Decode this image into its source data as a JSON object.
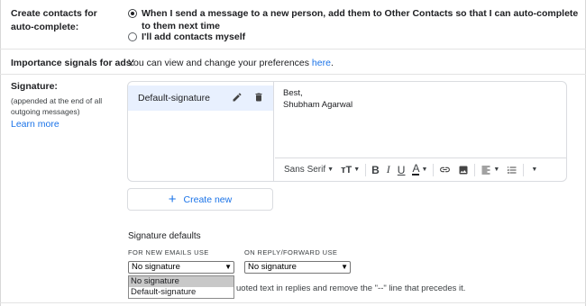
{
  "contacts": {
    "label": "Create contacts for auto-complete:",
    "options": [
      {
        "label": "When I send a message to a new person, add them to Other Contacts so that I can auto-complete to them next time",
        "checked": true
      },
      {
        "label": "I'll add contacts myself",
        "checked": false
      }
    ]
  },
  "ads": {
    "label": "Importance signals for ads:",
    "text": "You can view and change your preferences",
    "link": "here",
    "period": "."
  },
  "signature": {
    "label": "Signature:",
    "sublabel_1": "(appended at the end of all",
    "sublabel_2": "outgoing messages)",
    "learn_more": "Learn more",
    "items": [
      {
        "name": "Default-signature"
      }
    ],
    "content_line1": "Best,",
    "content_line2": "Shubham Agarwal",
    "toolbar": {
      "font": "Sans Serif",
      "icons": [
        "text-size-icon",
        "bold-icon",
        "italic-icon",
        "underline-icon",
        "text-color-icon",
        "link-icon",
        "image-icon",
        "align-icon",
        "list-icon",
        "more-icon"
      ]
    },
    "create_new": "Create new"
  },
  "defaults": {
    "title": "Signature defaults",
    "new_emails_label": "FOR NEW EMAILS USE",
    "reply_label": "ON REPLY/FORWARD USE",
    "new_emails_value": "No signature",
    "reply_value": "No signature",
    "dropdown_options": [
      "No signature",
      "Default-signature"
    ],
    "quoted_text": "uoted text in replies and remove the \"--\" line that precedes it."
  },
  "colors": {
    "accent": "#1a73e8",
    "selected_bg": "#e8f0fe"
  }
}
